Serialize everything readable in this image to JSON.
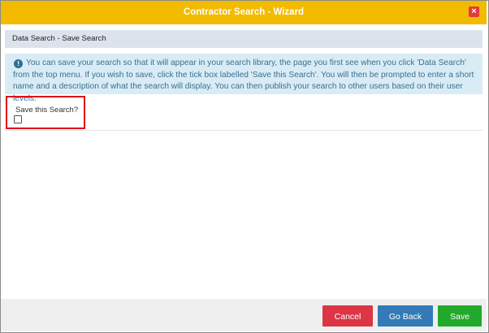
{
  "window": {
    "title": "Contractor Search - Wizard",
    "close_glyph": "×"
  },
  "section": {
    "title": "Data Search - Save Search"
  },
  "info": {
    "icon": "info-icon",
    "text": "You can save your search so that it will appear in your search library, the page you first see when you click 'Data Search' from the top menu. If you wish to save, click the tick box labelled 'Save this Search'. You will then be prompted to enter a short name and a description of what the search will display. You can then publish your search to other users based on their user levels."
  },
  "form": {
    "save_label": "Save this Search?",
    "save_checked": false
  },
  "footer": {
    "cancel_label": "Cancel",
    "back_label": "Go Back",
    "save_label": "Save"
  },
  "colors": {
    "title_bar": "#f2bb00",
    "cancel": "#dc3545",
    "go_back": "#337ab7",
    "save": "#22a92b",
    "highlight": "#e0001b"
  }
}
